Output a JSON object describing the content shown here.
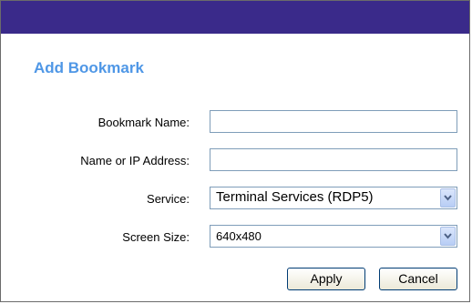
{
  "dialog": {
    "heading": "Add Bookmark",
    "fields": {
      "bookmark_name": {
        "label": "Bookmark Name:",
        "value": "",
        "placeholder": ""
      },
      "address": {
        "label": "Name or IP Address:",
        "value": "",
        "placeholder": ""
      },
      "service": {
        "label": "Service:",
        "selected": "Terminal Services (RDP5)"
      },
      "screen_size": {
        "label": "Screen Size:",
        "selected": "640x480"
      }
    },
    "buttons": {
      "apply": "Apply",
      "cancel": "Cancel"
    }
  },
  "colors": {
    "titlebar": "#3a2a8a",
    "heading": "#4f97e6",
    "field_border": "#7f9db9"
  },
  "icons": {
    "dropdown": "chevron-down-icon"
  }
}
